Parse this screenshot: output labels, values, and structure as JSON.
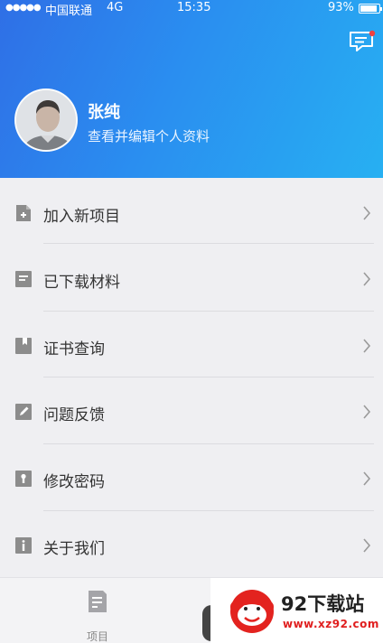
{
  "status_bar": {
    "signal": "●●●●●",
    "carrier": "中国联通",
    "network": "4G",
    "time": "15:35",
    "battery": "93%"
  },
  "header": {
    "message_icon": "chat-message-icon",
    "user_name": "张纯",
    "user_subtitle": "查看并编辑个人资料",
    "accent_from": "#2f6fe6",
    "accent_to": "#27b0f2"
  },
  "menu": {
    "items": [
      {
        "label": "加入新项目",
        "icon": "add-document-icon"
      },
      {
        "label": "已下载材料",
        "icon": "document-icon"
      },
      {
        "label": "证书查询",
        "icon": "bookmark-icon"
      },
      {
        "label": "问题反馈",
        "icon": "edit-icon"
      },
      {
        "label": "修改密码",
        "icon": "lock-icon"
      },
      {
        "label": "关于我们",
        "icon": "info-icon"
      }
    ]
  },
  "tabbar": {
    "project_label": "项目"
  },
  "watermark": {
    "title": "92下载站",
    "url": "www.xz92.com"
  }
}
